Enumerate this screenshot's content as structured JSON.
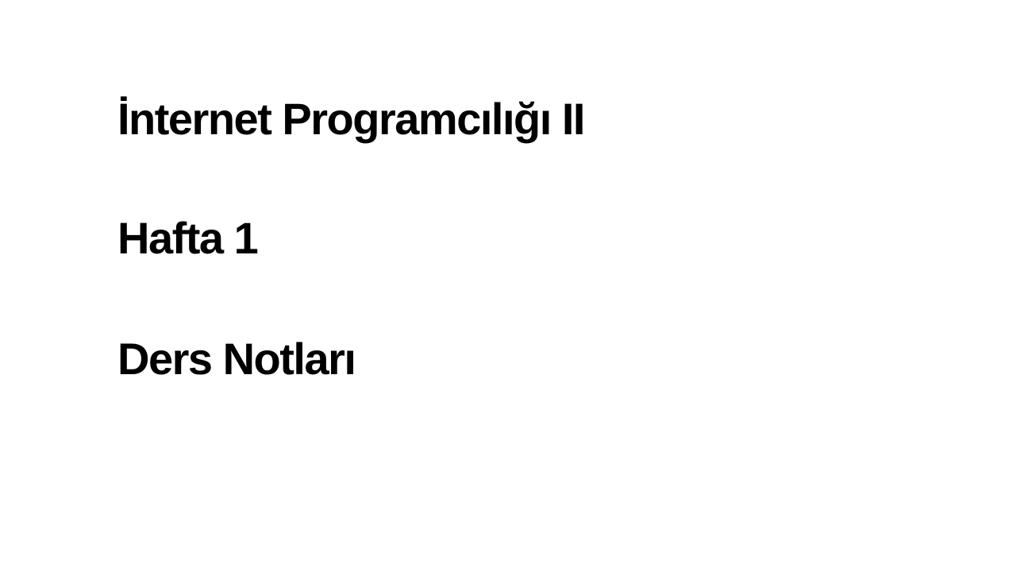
{
  "slide": {
    "title": "İnternet Programcılığı II",
    "week": "Hafta 1",
    "subtitle": "Ders Notları"
  },
  "colors": {
    "background": "#ffffff",
    "text": "#000000"
  }
}
